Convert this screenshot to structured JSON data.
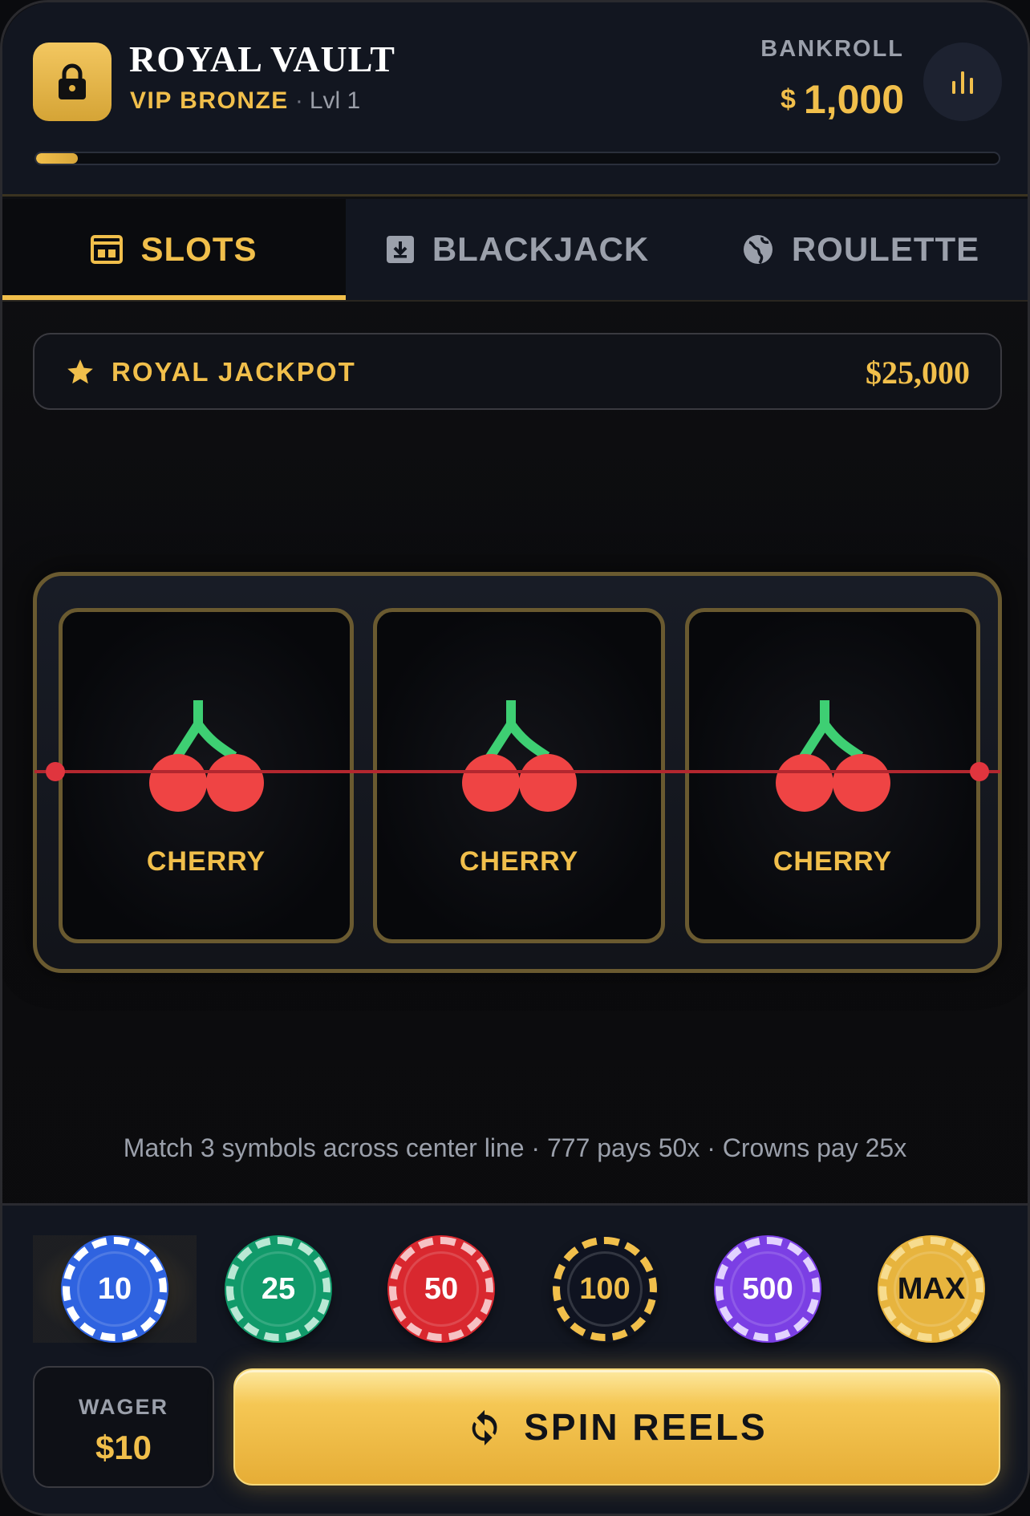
{
  "header": {
    "title": "ROYAL VAULT",
    "tier": "VIP BRONZE",
    "separator": "·",
    "level": "Lvl 1",
    "bankroll_label": "BANKROLL",
    "currency": "$",
    "bankroll_value": "1,000",
    "xp_progress_pct": 4.3,
    "lock_icon": "lock-icon",
    "stats_icon": "bar-chart-icon"
  },
  "tabs": [
    {
      "label": "SLOTS",
      "icon": "slot-machine-icon",
      "active": true
    },
    {
      "label": "BLACKJACK",
      "icon": "card-down-icon",
      "active": false
    },
    {
      "label": "ROULETTE",
      "icon": "globe-icon",
      "active": false
    }
  ],
  "jackpot": {
    "label": "ROYAL JACKPOT",
    "value": "$25,000",
    "icon": "star-icon"
  },
  "reels": [
    {
      "symbol": "CHERRY",
      "icon": "cherry-icon"
    },
    {
      "symbol": "CHERRY",
      "icon": "cherry-icon"
    },
    {
      "symbol": "CHERRY",
      "icon": "cherry-icon"
    }
  ],
  "rules_text": "Match 3 symbols across center line · 777 pays 50x · Crowns pay 25x",
  "chips": [
    {
      "label": "10",
      "color": "#2f63e0",
      "edge": "#ffffff",
      "selected": true
    },
    {
      "label": "25",
      "color": "#119a6a",
      "edge": "#b9e8d4",
      "selected": false
    },
    {
      "label": "50",
      "color": "#d9282f",
      "edge": "#f6c2c4",
      "selected": false
    },
    {
      "label": "100",
      "color": "#0f1320",
      "edge": "#f1bf4b",
      "selected": false
    },
    {
      "label": "500",
      "color": "#7b3fe4",
      "edge": "#e2d2ff",
      "selected": false
    },
    {
      "label": "MAX",
      "color": "#e7b43e",
      "edge": "#f7dc8e",
      "selected": false
    }
  ],
  "wager": {
    "label": "WAGER",
    "value": "$10"
  },
  "spin": {
    "label": "SPIN REELS",
    "icon": "refresh-icon"
  },
  "colors": {
    "accent": "#f1bf4b",
    "payline": "#b3272f",
    "cherry": "#ef4444",
    "stem": "#3ecf73"
  }
}
